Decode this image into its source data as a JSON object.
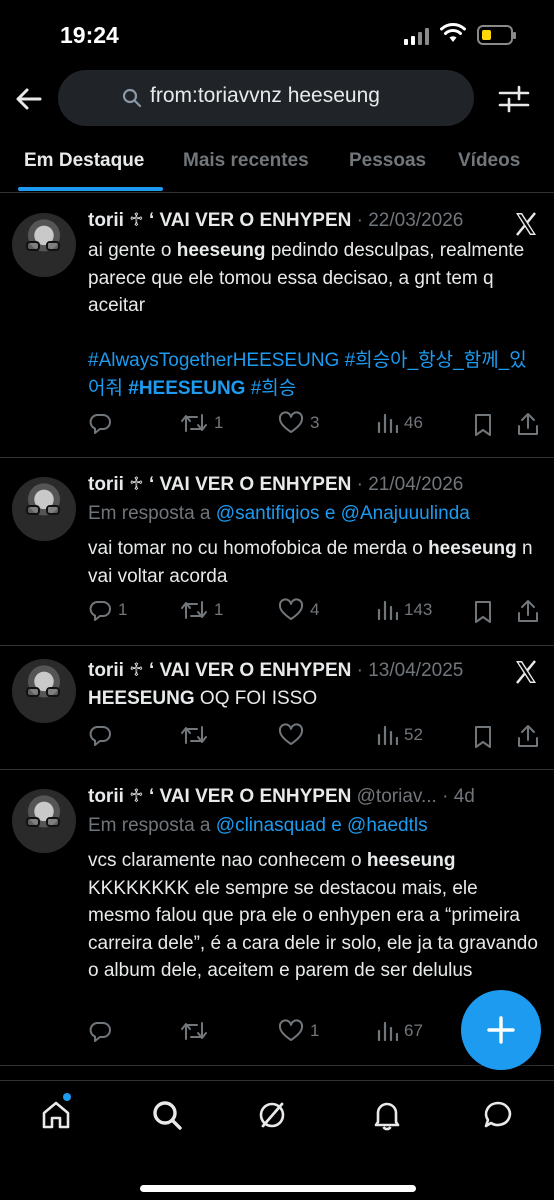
{
  "status_bar": {
    "time": "19:24"
  },
  "search": {
    "query": "from:toriavvnz heeseung"
  },
  "tabs": [
    {
      "label": "Em Destaque",
      "active": true
    },
    {
      "label": "Mais recentes",
      "active": false
    },
    {
      "label": "Pessoas",
      "active": false
    },
    {
      "label": "Vídeos",
      "active": false
    }
  ],
  "tweets": [
    {
      "name": "torii ♱ ‘ VAI VER O ENHYPEN",
      "meta": " · 22/03/2026",
      "reply_prefix": "",
      "reply_to": "",
      "text_before": "ai gente o ",
      "text_bold": "heeseung",
      "text_after": " pedindo desculpas, realmente parece que ele tomou essa decisao, a gnt tem q aceitar",
      "hashtag_1": "#AlwaysTogetherHEESEUNG",
      "hashtag_2": "#희승아_항상_함께_있어줘",
      "hashtag_3": "#HEESEUNG",
      "hashtag_4": "#희승",
      "replies": "",
      "retweets": "1",
      "likes": "3",
      "views": "46"
    },
    {
      "name": "torii ♱ ‘ VAI VER O ENHYPEN",
      "meta": " · 21/04/2026",
      "reply_prefix": "Em resposta a ",
      "reply_to": "@santifiqios e @Anajuuulinda",
      "text_before": "vai tomar no cu homofobica de merda o ",
      "text_bold": "heeseung",
      "text_after": " n vai voltar acorda",
      "replies": "1",
      "retweets": "1",
      "likes": "4",
      "views": "143"
    },
    {
      "name": "torii ♱ ‘ VAI VER O ENHYPEN",
      "meta": " · 13/04/2025",
      "reply_prefix": "",
      "reply_to": "",
      "text_before": "",
      "text_bold": "HEESEUNG",
      "text_after": " OQ FOI ISSO",
      "replies": "",
      "retweets": "",
      "likes": "",
      "views": "52"
    },
    {
      "name": "torii ♱ ‘ VAI VER O ENHYPEN",
      "meta": " @toriav... · 4d",
      "reply_prefix": "Em resposta a ",
      "reply_to": "@clinasquad e @haedtls",
      "text_before": "vcs claramente nao conhecem o ",
      "text_bold": "heeseung",
      "text_after": " KKKKKKKK ele sempre se destacou mais, ele mesmo falou que pra ele o enhypen era a “primeira carreira dele”, é a cara dele ir solo, ele ja ta gravando o album dele, aceitem e parem de ser delulus",
      "replies": "",
      "retweets": "",
      "likes": "1",
      "views": "67"
    }
  ],
  "colors": {
    "accent": "#1d9bf0",
    "muted": "#71767b",
    "text": "#e7e9ea",
    "divider": "#2f3336"
  }
}
